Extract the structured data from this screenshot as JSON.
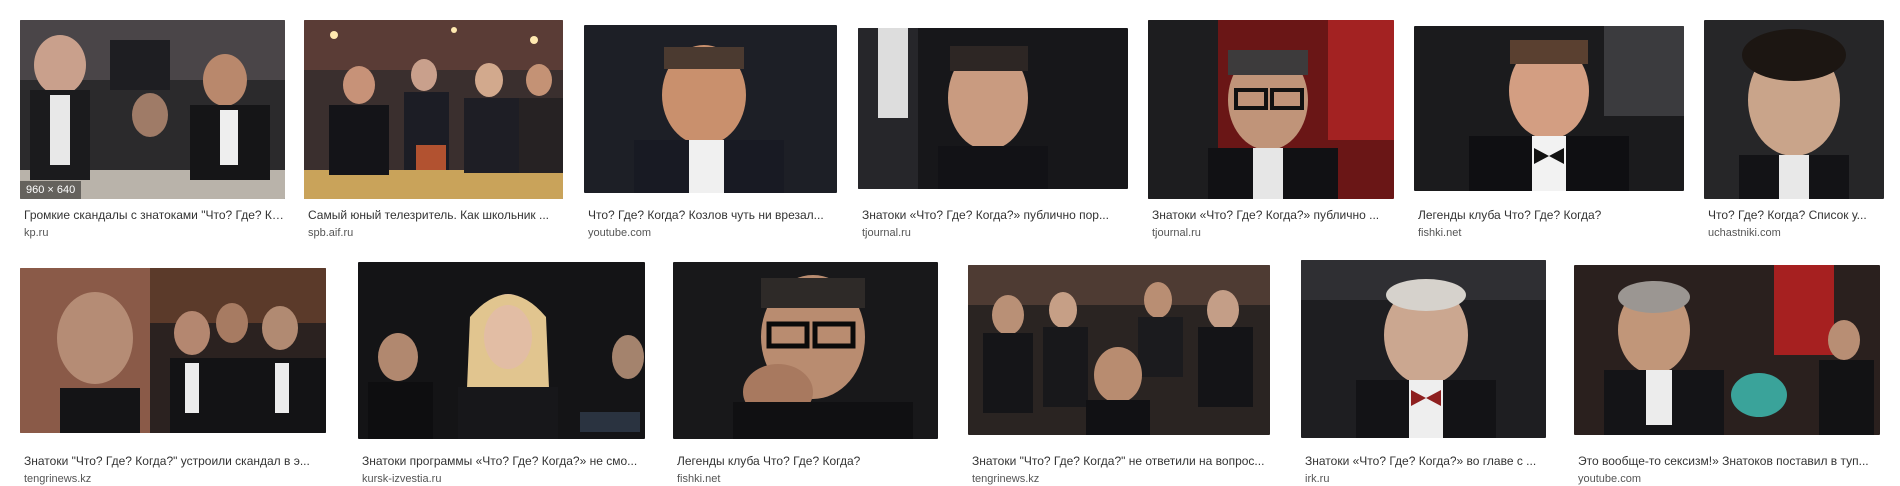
{
  "results": [
    {
      "title": "Громкие скандалы с знатоками \"Что? Где? Когда?\"",
      "source": "kp.ru",
      "size": "960 × 640",
      "img": "tv-studio-men-in-tuxedos-photo"
    },
    {
      "title": "Самый юный телезритель. Как школьник ...",
      "source": "spb.aif.ru",
      "img": "quiz-show-table-photo"
    },
    {
      "title": "Что? Где? Когда? Козлов чуть ни врезал...",
      "source": "youtube.com",
      "img": "man-portrait-photo"
    },
    {
      "title": "Знатоки «Что? Где? Когда?» публично пор...",
      "source": "tjournal.ru",
      "img": "man-portrait-photo"
    },
    {
      "title": "Знатоки «Что? Где? Когда?» публично ...",
      "source": "tjournal.ru",
      "img": "man-with-glasses-photo"
    },
    {
      "title": "Легенды клуба Что? Где? Когда?",
      "source": "fishki.net",
      "img": "man-in-bowtie-photo"
    },
    {
      "title": "Что? Где? Когда? Список у...",
      "source": "uchastniki.com",
      "img": "man-portrait-photo"
    },
    {
      "title": "Знатоки \"Что? Где? Когда?\" устроили скандал в э...",
      "source": "tengrinews.kz",
      "img": "players-collage-photo"
    },
    {
      "title": "Знатоки программы «Что? Где? Когда?» не смо...",
      "source": "kursk-izvestia.ru",
      "img": "woman-blonde-photo"
    },
    {
      "title": "Легенды клуба Что? Где? Когда?",
      "source": "fishki.net",
      "img": "man-with-glasses-photo"
    },
    {
      "title": "Знатоки \"Что? Где? Когда?\" не ответили на вопрос...",
      "source": "tengrinews.kz",
      "img": "players-group-photo"
    },
    {
      "title": "Знатоки «Что? Где? Когда?» во главе с ...",
      "source": "irk.ru",
      "img": "gray-haired-man-photo"
    },
    {
      "title": "Это вообще-то сексизм!» Знатоков поставил в туп...",
      "source": "youtube.com",
      "img": "older-man-with-mustache-photo"
    }
  ]
}
